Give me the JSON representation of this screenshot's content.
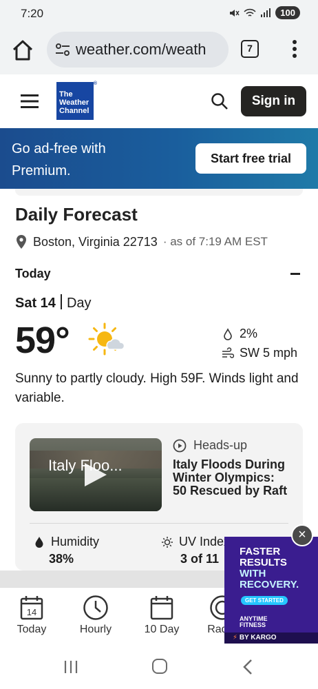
{
  "status_bar": {
    "time": "7:20",
    "battery": "100"
  },
  "browser": {
    "url": "weather.com/weath",
    "tab_count": "7"
  },
  "site_header": {
    "logo_text": "The Weather Channel",
    "sign_in_label": "Sign in"
  },
  "premium_banner": {
    "text": "Go ad-free with Premium.",
    "cta_label": "Start free trial"
  },
  "forecast": {
    "title": "Daily Forecast",
    "location": "Boston, Virginia 22713",
    "as_of": "· as of 7:19 AM EST",
    "section_label": "Today",
    "date": "Sat 14",
    "period": "Day",
    "temperature": "59°",
    "precip_chance": "2%",
    "wind": "SW 5 mph",
    "narrative": "Sunny to partly cloudy. High 59F. Winds light and variable.",
    "weather_icon": "partly-sunny-icon"
  },
  "details_card": {
    "video_title": "Italy Floo...",
    "headsup_label": "Heads-up",
    "headsup_title": "Italy Floods During Winter Olympics: 50 Rescued by Raft",
    "humidity_label": "Humidity",
    "humidity_value": "38%",
    "uv_label": "UV Index",
    "uv_value": "3 of 11"
  },
  "bottom_nav": {
    "items": [
      {
        "label": "Today",
        "icon": "calendar-day-icon",
        "day_number": "14"
      },
      {
        "label": "Hourly",
        "icon": "clock-icon"
      },
      {
        "label": "10 Day",
        "icon": "calendar-icon"
      },
      {
        "label": "Radar",
        "icon": "radar-icon"
      }
    ]
  },
  "ad": {
    "headline_1": "FASTER",
    "headline_2": "RESULTS",
    "headline_3": "WITH",
    "headline_4": "RECOVERY.",
    "cta": "GET STARTED",
    "brand_1": "ANYTIME",
    "brand_2": "FITNESS",
    "sponsor": "BY KARGO",
    "close": "×"
  },
  "colors": {
    "banner_start": "#1b4c8e",
    "banner_end": "#1f7aa8",
    "logo_blue": "#1746a2",
    "sign_in_bg": "#252422",
    "ad_purple": "#3a1d8f",
    "sun_yellow": "#f6b712"
  }
}
